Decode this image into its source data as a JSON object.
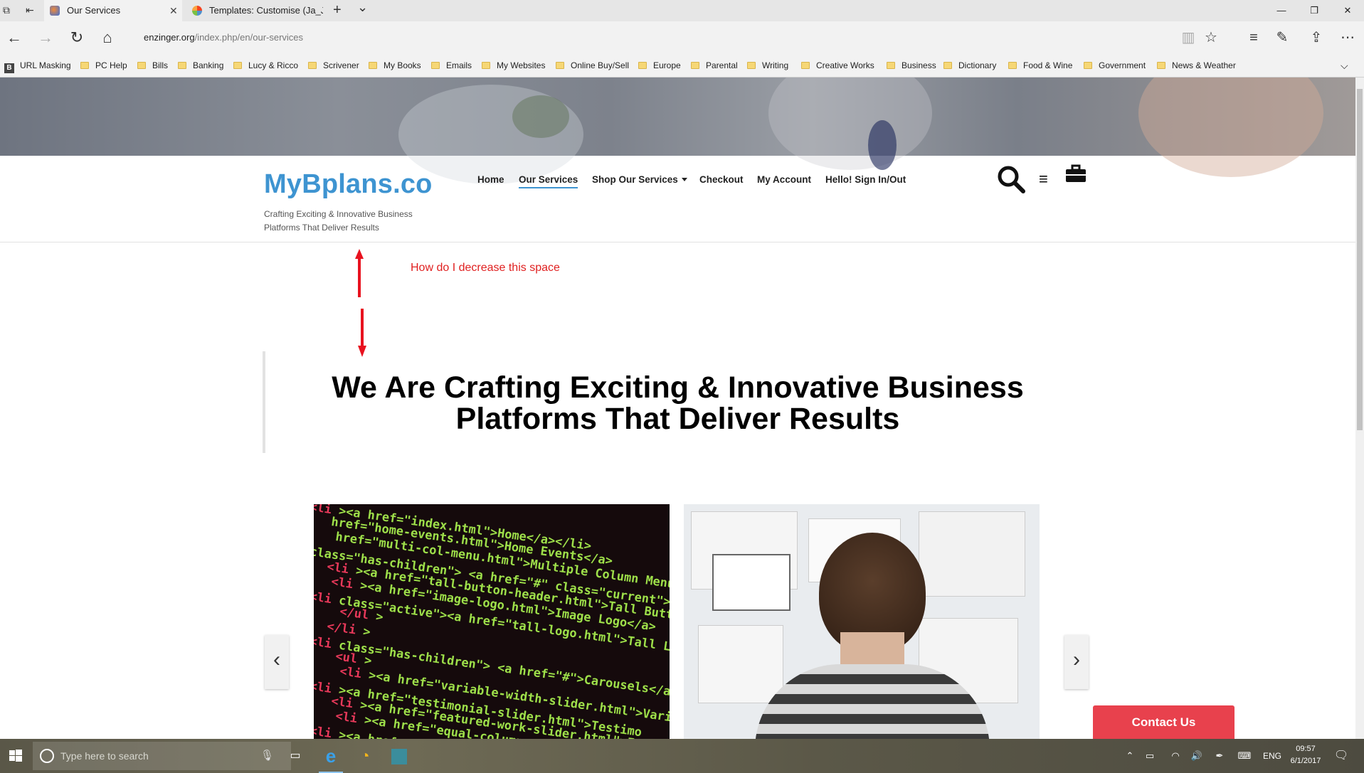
{
  "browser": {
    "tabs": [
      {
        "label": "Our Services",
        "active": true
      },
      {
        "label": "Templates: Customise (Ja_Ja",
        "active": false
      }
    ],
    "new_tab": "+",
    "tab_list": "⌄",
    "address": {
      "host": "enzinger.org",
      "path": "/index.php/en/our-services"
    },
    "favorites": [
      {
        "label": "URL Masking",
        "icon": "b-icon"
      },
      {
        "label": "PC Help",
        "icon": "folder-icon"
      },
      {
        "label": "Bills",
        "icon": "folder-icon"
      },
      {
        "label": "Banking",
        "icon": "folder-icon"
      },
      {
        "label": "Lucy & Ricco",
        "icon": "folder-icon"
      },
      {
        "label": "Scrivener",
        "icon": "folder-icon"
      },
      {
        "label": "My Books",
        "icon": "folder-icon"
      },
      {
        "label": "Emails",
        "icon": "folder-icon"
      },
      {
        "label": "My Websites",
        "icon": "folder-icon"
      },
      {
        "label": "Online Buy/Sell",
        "icon": "folder-icon"
      },
      {
        "label": "Europe",
        "icon": "folder-icon"
      },
      {
        "label": "Parental",
        "icon": "folder-icon"
      },
      {
        "label": "Writing",
        "icon": "folder-icon"
      },
      {
        "label": "Creative  Works",
        "icon": "folder-icon"
      },
      {
        "label": "Business",
        "icon": "folder-icon"
      },
      {
        "label": "Dictionary",
        "icon": "folder-icon"
      },
      {
        "label": "Food & Wine",
        "icon": "folder-icon"
      },
      {
        "label": "Government",
        "icon": "folder-icon"
      },
      {
        "label": "News & Weather",
        "icon": "folder-icon"
      }
    ]
  },
  "site": {
    "logo": "MyBplans.co",
    "tagline": "Crafting Exciting & Innovative Business Platforms That Deliver Results",
    "menu": [
      {
        "label": "Home",
        "active": false
      },
      {
        "label": "Our Services",
        "active": true
      },
      {
        "label": "Shop Our Services",
        "active": false,
        "dropdown": true
      },
      {
        "label": "Checkout",
        "active": false
      },
      {
        "label": "My Account",
        "active": false
      },
      {
        "label": "Hello! Sign In/Out",
        "active": false
      }
    ],
    "annotation": "How do I decrease this space",
    "headline": "We Are Crafting Exciting & Innovative Business Platforms That Deliver Results",
    "contact_button": "Contact Us",
    "code_lines": [
      "<li><a href=\"index.html\">Home</a></li>",
      "href=\"home-events.html\">Home Events</a>",
      "href=\"multi-col-menu.html\">Multiple Column Menu",
      "class=\"has-children\"> <a href=\"#\" class=\"current\">",
      "<li><a href=\"tall-button-header.html\">Tall Button He",
      "<li><a href=\"image-logo.html\">Image Logo</a>",
      "<li class=\"active\"><a href=\"tall-logo.html\">Tall L",
      "</ul>",
      "</li>",
      "<li class=\"has-children\"> <a href=\"#\">Carousels</a>",
      "<ul>",
      "<li><a href=\"variable-width-slider.html\">Varia",
      "<li><a href=\"testimonial-slider.html\">Testimo",
      "<li><a href=\"featured-work-slider.html\">Featu",
      "<li><a href=\"equal-column-slider.html\">Equal",
      "<li><a href=\"video-slider.html\">Video"
    ],
    "colors": {
      "logo": "#3e94d1",
      "annotation": "#e02020",
      "contact": "#e8414d",
      "code_green": "#9ee04a",
      "code_red": "#e8395a"
    }
  },
  "taskbar": {
    "search_placeholder": "Type here to search",
    "language": "ENG",
    "time": "09:57",
    "date": "6/1/2017"
  }
}
